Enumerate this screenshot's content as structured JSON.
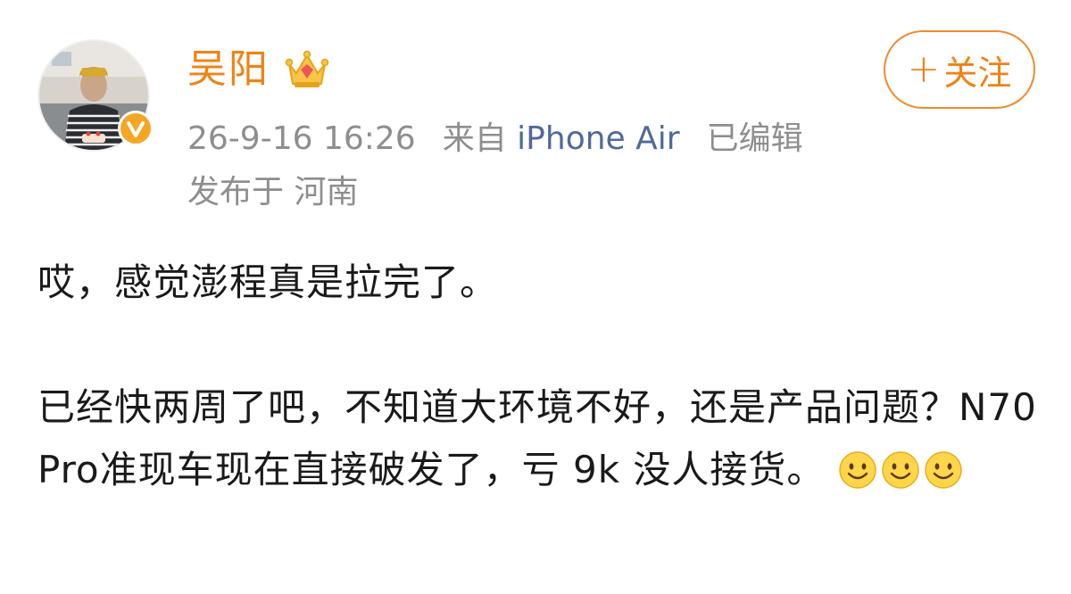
{
  "user": {
    "name": "吴阳",
    "avatar_icon": "user-photo-icon",
    "badge_icon": "verified-v-icon",
    "vip_icon": "crown-icon"
  },
  "follow_button": {
    "plus": "+",
    "label": "关注"
  },
  "meta": {
    "timestamp": "26-9-16 16:26",
    "source_prefix": "来自",
    "source_device": "iPhone Air",
    "edited": "已编辑",
    "location": "发布于 河南"
  },
  "post": {
    "paragraph_1": "哎，感觉澎程真是拉完了。",
    "paragraph_2": "已经快两周了吧，不知道大环境不好，还是产品问题？N70 Pro准现车现在直接破发了，亏 9k 没人接货。",
    "trailing_emojis": [
      "smile-emoji-icon",
      "smile-emoji-icon",
      "smile-emoji-icon"
    ]
  },
  "colors": {
    "accent": "#f08215",
    "meta_gray": "#8e8e8e",
    "link_blue": "#506a99",
    "text": "#1a1a1a"
  }
}
